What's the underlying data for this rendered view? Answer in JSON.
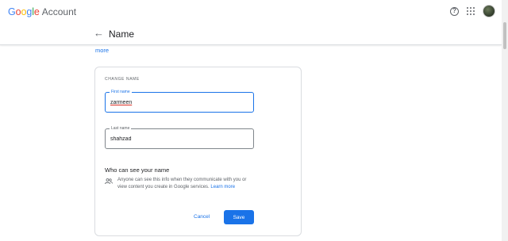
{
  "header": {
    "brand_google": "Google",
    "brand_account": "Account",
    "help_icon": "help-circle-icon",
    "apps_icon": "apps-grid-icon",
    "avatar": "user-avatar"
  },
  "page": {
    "title": "Name",
    "back_icon": "arrow-back-icon",
    "more_link": "more"
  },
  "form": {
    "section_label": "CHANGE NAME",
    "first_name": {
      "label": "First name",
      "value": "zarmeen"
    },
    "last_name": {
      "label": "Last name",
      "value": "shahzad"
    },
    "visibility_heading": "Who can see your name",
    "visibility_text": "Anyone can see this info when they communicate with you or view content you create in Google services.",
    "learn_more": "Learn more",
    "cancel_label": "Cancel",
    "save_label": "Save"
  },
  "colors": {
    "accent": "#1a73e8",
    "border": "#dadce0",
    "text": "#202124",
    "muted": "#5f6368"
  }
}
